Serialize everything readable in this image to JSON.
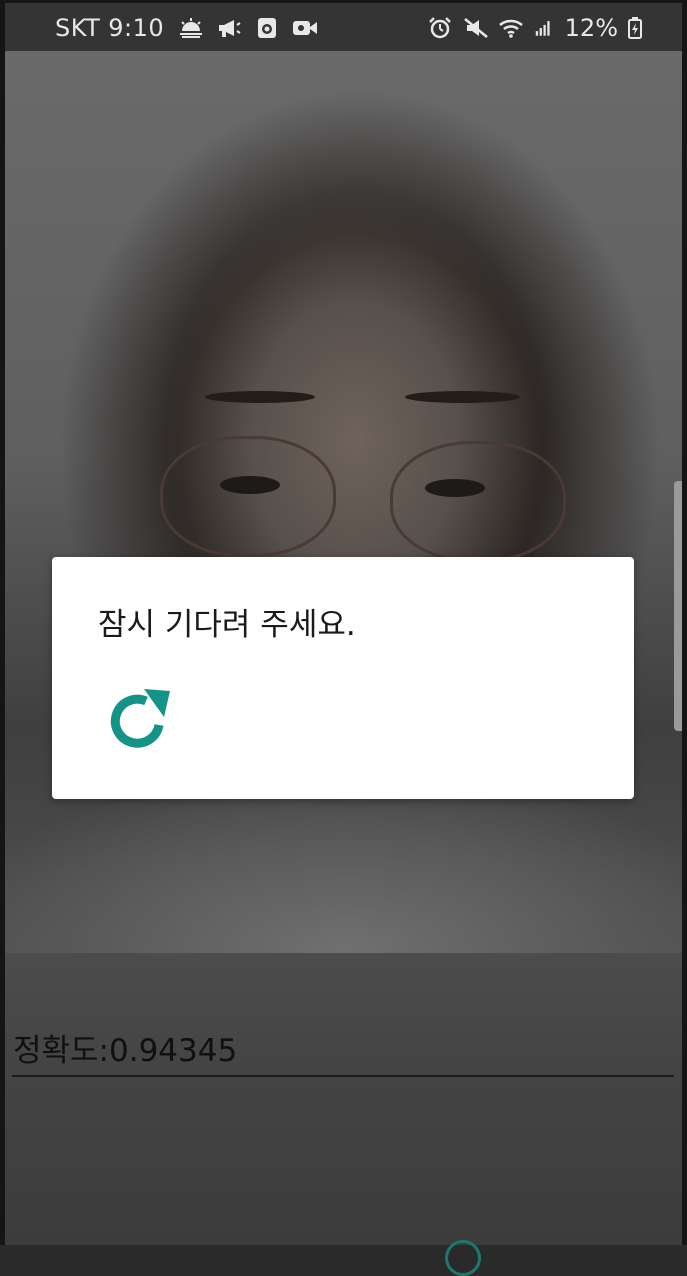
{
  "status_bar": {
    "carrier": "SKT",
    "time": "9:10",
    "battery_percent": "12%",
    "icons_left": [
      "weather-icon",
      "megaphone-icon",
      "camera-app-icon",
      "video-icon"
    ],
    "icons_right": [
      "alarm-icon",
      "mute-icon",
      "wifi-icon",
      "signal-icon",
      "battery-charging-icon"
    ]
  },
  "dialog": {
    "message": "잠시 기다려 주세요.",
    "icon": "refresh-icon",
    "accent_color": "#149488"
  },
  "panel": {
    "accuracy_text": "정확도:0.94345"
  }
}
